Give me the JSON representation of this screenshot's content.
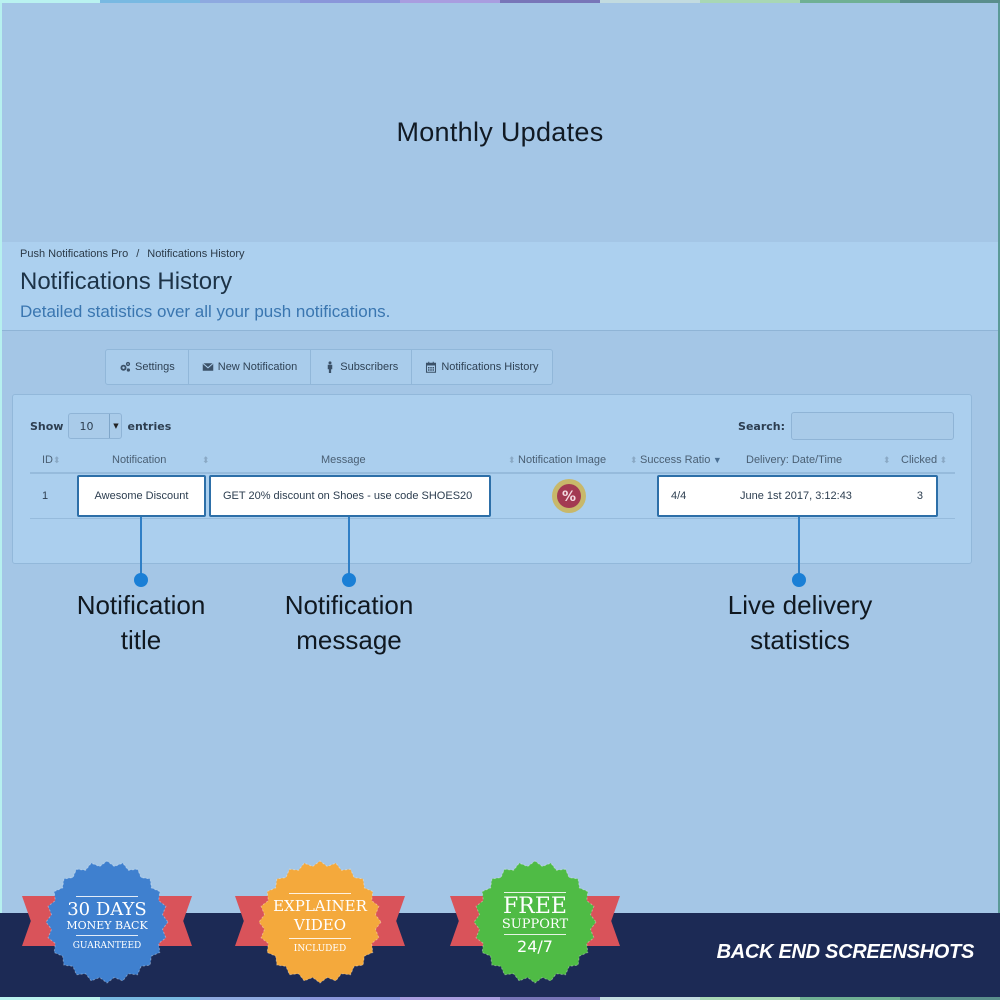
{
  "hero": {
    "title": "Monthly Updates"
  },
  "breadcrumb": {
    "root": "Push Notifications Pro",
    "separator": "/",
    "current": "Notifications History"
  },
  "header": {
    "title": "Notifications History",
    "subtitle": "Detailed statistics over all your push notifications."
  },
  "toolbar": {
    "items": [
      {
        "icon": "gears-icon",
        "label": "Settings"
      },
      {
        "icon": "envelope-icon",
        "label": "New Notification"
      },
      {
        "icon": "user-icon",
        "label": "Subscribers"
      },
      {
        "icon": "calendar-icon",
        "label": "Notifications History"
      }
    ]
  },
  "table_controls": {
    "show_label": "Show",
    "page_size": "10",
    "entries_label": "entries",
    "search_label": "Search:",
    "search_value": ""
  },
  "table": {
    "columns": [
      "ID",
      "Notification",
      "Message",
      "Notification Image",
      "Success Ratio",
      "Delivery: Date/Time",
      "Clicked"
    ],
    "sorted_column": "Success Ratio",
    "rows": [
      {
        "id": "1",
        "notification": "Awesome Discount",
        "message": "GET 20% discount on Shoes - use code SHOES20",
        "image_icon": "percent-badge-icon",
        "success_ratio": "4/4",
        "delivery": "June 1st 2017, 3:12:43",
        "clicked": "3"
      }
    ]
  },
  "callouts": {
    "title": {
      "line1": "Notification",
      "line2": "title"
    },
    "message": {
      "line1": "Notification",
      "line2": "message"
    },
    "stats": {
      "line1": "Live delivery",
      "line2": "statistics"
    }
  },
  "badges": [
    {
      "line1": "30 DAYS",
      "line2": "MONEY BACK",
      "line3": "GUARANTEED",
      "color": "#3f80cf"
    },
    {
      "line1": "EXPLAINER",
      "line2": "VIDEO",
      "line3": "INCLUDED",
      "color": "#f4a93c"
    },
    {
      "line1": "FREE",
      "line2": "SUPPORT",
      "line3": "24/7",
      "color": "#4fbb45"
    }
  ],
  "footer": {
    "label": "BACK END SCREENSHOTS"
  },
  "colors": {
    "background": "#a4c6e6",
    "footer_band": "#1c2a55",
    "callout_accent": "#1a7fd6",
    "ribbon": "#d9535a"
  }
}
